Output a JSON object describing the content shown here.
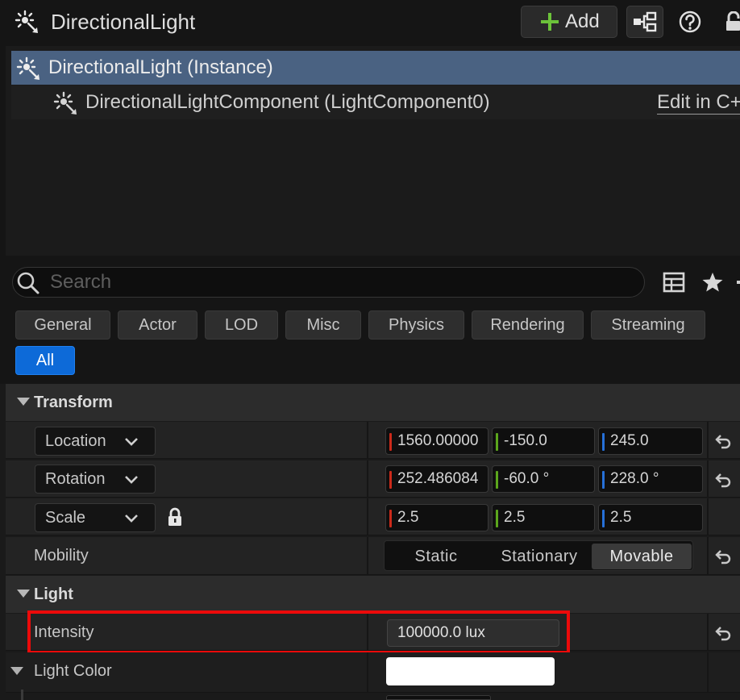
{
  "header": {
    "title": "DirectionalLight",
    "add_label": "Add",
    "icons": [
      "directional-light-icon",
      "plus-icon",
      "blueprint-icon",
      "help-icon",
      "lock-icon"
    ]
  },
  "tree": {
    "instance_label": "DirectionalLight (Instance)",
    "component_label": "DirectionalLightComponent (LightComponent0)",
    "edit_link": "Edit in C++"
  },
  "search": {
    "placeholder": "Search",
    "value": ""
  },
  "filters": [
    "General",
    "Actor",
    "LOD",
    "Misc",
    "Physics",
    "Rendering",
    "Streaming",
    "All"
  ],
  "filters_active": "All",
  "transform": {
    "category": "Transform",
    "location": {
      "label": "Location",
      "x": "1560.00000",
      "y": "-150.0",
      "z": "245.0"
    },
    "rotation": {
      "label": "Rotation",
      "x": "252.486084",
      "y": "-60.0 °",
      "z": "228.0 °"
    },
    "scale": {
      "label": "Scale",
      "x": "2.5",
      "y": "2.5",
      "z": "2.5"
    },
    "mobility": {
      "label": "Mobility",
      "options": [
        "Static",
        "Stationary",
        "Movable"
      ],
      "selected": "Movable"
    }
  },
  "light": {
    "category": "Light",
    "intensity_label": "Intensity",
    "intensity_value": "100000.0 lux",
    "color_label": "Light Color",
    "color_value": "#ffffff"
  },
  "colors": {
    "selection": "#4a6282",
    "accent": "#0d6ad8",
    "highlight": "#ec0a0a",
    "axis_x": "#cc2a1a",
    "axis_y": "#5ca61c",
    "axis_z": "#2670d8"
  }
}
